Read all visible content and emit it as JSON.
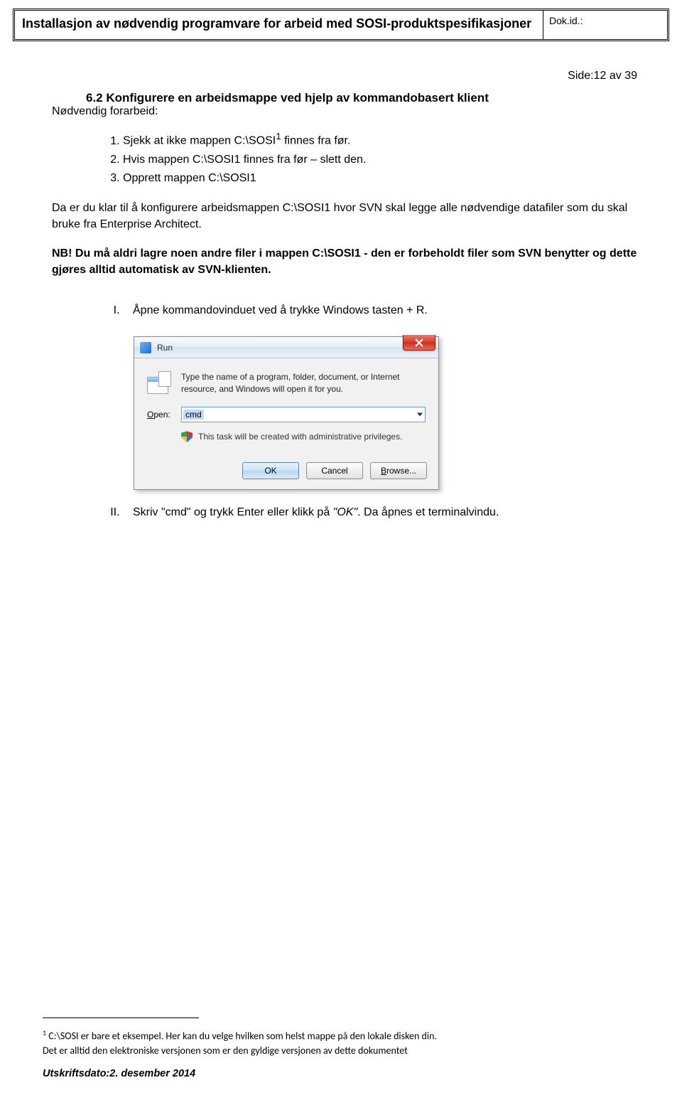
{
  "header": {
    "title": "Installasjon av nødvendig programvare for arbeid med SOSI-produktspesifikasjoner",
    "dokid_label": "Dok.id.:"
  },
  "page_number": "Side:12 av 39",
  "section": {
    "number": "6.2",
    "title": "Konfigurere en arbeidsmappe ved hjelp av kommandobasert klient"
  },
  "intro": "Nødvendig forarbeid:",
  "prechecks": {
    "i1_a": "Sjekk at ikke mappen C:\\SOSI",
    "i1_b": " finnes fra før.",
    "i2": "Hvis mappen C:\\SOSI1 finnes fra før – slett den.",
    "i3": "Opprett mappen C:\\SOSI1"
  },
  "body_p": "Da er du klar til å konfigurere arbeidsmappen C:\\SOSI1 hvor SVN skal legge alle nødvendige datafiler som du skal bruke fra Enterprise Architect.",
  "nb": "NB! Du må aldri lagre noen andre filer i mappen C:\\SOSI1 - den er forbeholdt filer som SVN benytter og dette gjøres alltid automatisk av SVN-klienten.",
  "steps": {
    "s1": "Åpne kommandovinduet ved å trykke Windows tasten + R.",
    "s2_a": "Skriv \"cmd\" og trykk Enter eller klikk på ",
    "s2_ok": "\"OK\"",
    "s2_b": ".  Da åpnes et terminalvindu."
  },
  "run_dialog": {
    "title": "Run",
    "desc": "Type the name of a program, folder, document, or Internet resource, and Windows will open it for you.",
    "open_label_u": "O",
    "open_label_rest": "pen:",
    "value": "cmd",
    "priv": "This task will be created with administrative privileges.",
    "ok": "OK",
    "cancel": "Cancel",
    "browse_u": "B",
    "browse_rest": "rowse..."
  },
  "footnote": {
    "text": " C:\\SOSI er bare et eksempel. Her kan du velge hvilken som helst mappe på den lokale disken din.",
    "disclaimer": "Det er alltid den elektroniske versjonen som er den gyldige versjonen av dette dokumentet",
    "print": "Utskriftsdato:2. desember 2014"
  }
}
